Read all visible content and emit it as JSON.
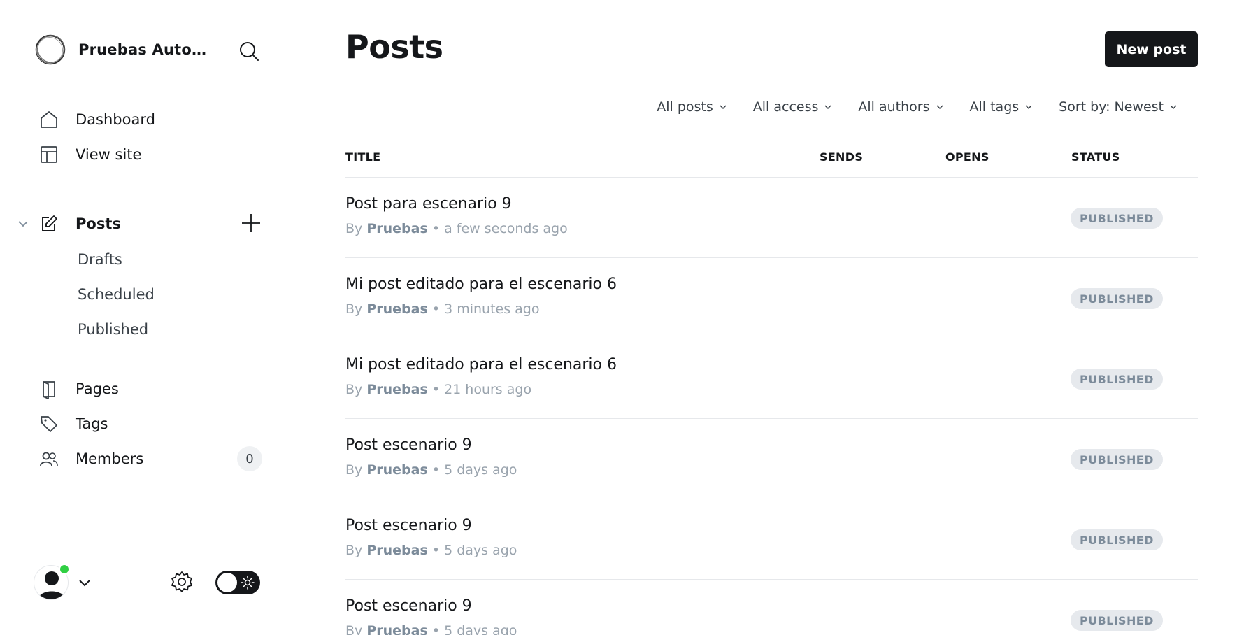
{
  "sidebar": {
    "site_name": "Pruebas Automa...",
    "nav": {
      "dashboard": "Dashboard",
      "view_site": "View site",
      "posts": "Posts",
      "drafts": "Drafts",
      "scheduled": "Scheduled",
      "published": "Published",
      "pages": "Pages",
      "tags": "Tags",
      "members": "Members",
      "members_count": "0"
    },
    "status_color": "#30cf43"
  },
  "main": {
    "title": "Posts",
    "new_post_label": "New post",
    "filters": [
      "All posts",
      "All access",
      "All authors",
      "All tags",
      "Sort by: Newest"
    ],
    "columns": {
      "title": "TITLE",
      "sends": "SENDS",
      "opens": "OPENS",
      "status": "STATUS"
    },
    "posts": [
      {
        "title": "Post para escenario 9",
        "by": "By",
        "author": "Pruebas",
        "time": "• a few seconds ago",
        "status": "PUBLISHED"
      },
      {
        "title": "Mi post editado para el escenario 6",
        "by": "By",
        "author": "Pruebas",
        "time": "• 3 minutes ago",
        "status": "PUBLISHED"
      },
      {
        "title": "Mi post editado para el escenario 6",
        "by": "By",
        "author": "Pruebas",
        "time": "• 21 hours ago",
        "status": "PUBLISHED"
      },
      {
        "title": "Post escenario 9",
        "by": "By",
        "author": "Pruebas",
        "time": "• 5 days ago",
        "status": "PUBLISHED"
      },
      {
        "title": "Post escenario 9",
        "by": "By",
        "author": "Pruebas",
        "time": "• 5 days ago",
        "status": "PUBLISHED"
      },
      {
        "title": "Post escenario 9",
        "by": "By",
        "author": "Pruebas",
        "time": "• 5 days ago",
        "status": "PUBLISHED"
      }
    ]
  },
  "icons": [
    "site-logo-icon",
    "search-icon",
    "home-icon",
    "layout-icon",
    "chevron-down-icon",
    "edit-icon",
    "plus-icon",
    "book-icon",
    "tag-icon",
    "members-icon",
    "avatar-icon",
    "gear-icon",
    "sun-icon"
  ]
}
